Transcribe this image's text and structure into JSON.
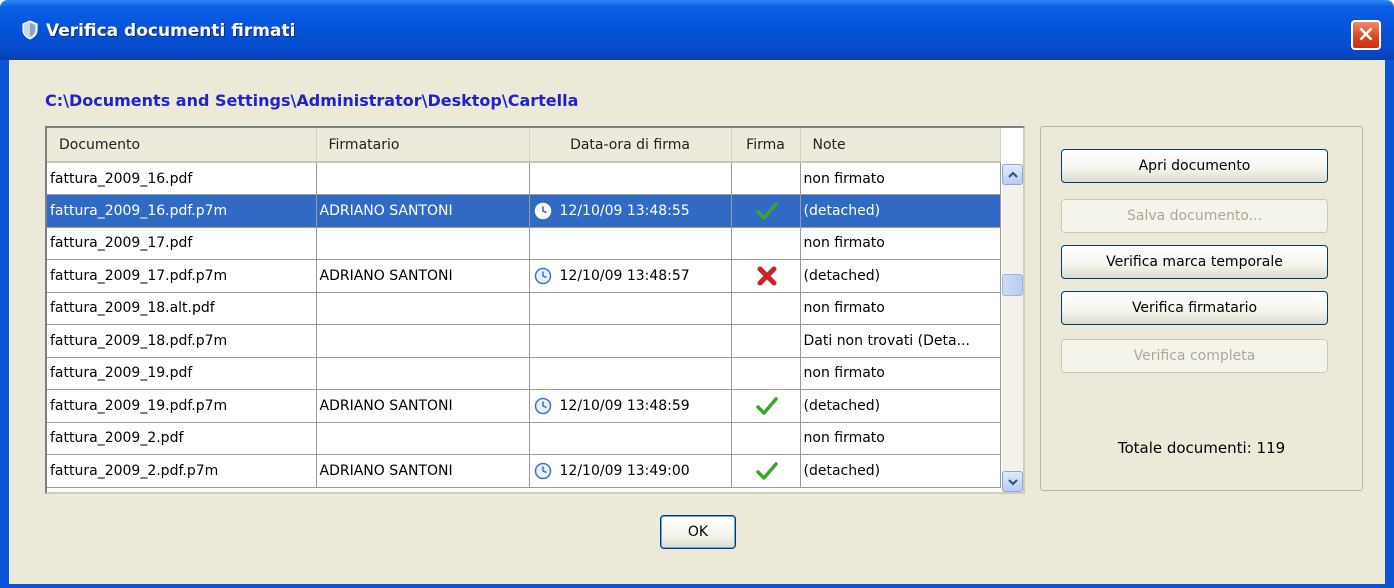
{
  "window": {
    "title": "Verifica documenti firmati",
    "close_label": "×"
  },
  "path": "C:\\Documents and Settings\\Administrator\\Desktop\\Cartella",
  "table": {
    "columns": [
      "Documento",
      "Firmatario",
      "Data-ora di firma",
      "Firma",
      "Note"
    ],
    "rows": [
      {
        "documento": "fattura_2009_16.pdf",
        "firmatario": "",
        "data": "",
        "firma": "",
        "note": "non firmato",
        "selected": false
      },
      {
        "documento": "fattura_2009_16.pdf.p7m",
        "firmatario": "ADRIANO SANTONI",
        "data": "12/10/09 13:48:55",
        "firma": "valid",
        "note": "(detached)",
        "selected": true
      },
      {
        "documento": "fattura_2009_17.pdf",
        "firmatario": "",
        "data": "",
        "firma": "",
        "note": "non firmato",
        "selected": false
      },
      {
        "documento": "fattura_2009_17.pdf.p7m",
        "firmatario": "ADRIANO SANTONI",
        "data": "12/10/09 13:48:57",
        "firma": "invalid",
        "note": "(detached)",
        "selected": false
      },
      {
        "documento": "fattura_2009_18.alt.pdf",
        "firmatario": "",
        "data": "",
        "firma": "",
        "note": "non firmato",
        "selected": false
      },
      {
        "documento": "fattura_2009_18.pdf.p7m",
        "firmatario": "",
        "data": "",
        "firma": "",
        "note": "Dati non trovati (Deta...",
        "selected": false
      },
      {
        "documento": "fattura_2009_19.pdf",
        "firmatario": "",
        "data": "",
        "firma": "",
        "note": "non firmato",
        "selected": false
      },
      {
        "documento": "fattura_2009_19.pdf.p7m",
        "firmatario": "ADRIANO SANTONI",
        "data": "12/10/09 13:48:59",
        "firma": "valid",
        "note": "(detached)",
        "selected": false
      },
      {
        "documento": "fattura_2009_2.pdf",
        "firmatario": "",
        "data": "",
        "firma": "",
        "note": "non firmato",
        "selected": false
      },
      {
        "documento": "fattura_2009_2.pdf.p7m",
        "firmatario": "ADRIANO SANTONI",
        "data": "12/10/09 13:49:00",
        "firma": "valid",
        "note": "(detached)",
        "selected": false
      }
    ]
  },
  "actions": {
    "apri_documento": "Apri documento",
    "salva_documento": "Salva documento...",
    "verifica_marca_temporale": "Verifica marca temporale",
    "verifica_firmatario": "Verifica firmatario",
    "verifica_completa": "Verifica completa"
  },
  "totale_documenti": "Totale documenti: 119",
  "ok_label": "OK",
  "colors": {
    "titlebar": "#0553d8",
    "selection": "#316ac5",
    "path_text": "#2222cc",
    "dialog_bg": "#ece9d8",
    "check_green": "#3aa52a",
    "cross_red": "#d0202a"
  }
}
